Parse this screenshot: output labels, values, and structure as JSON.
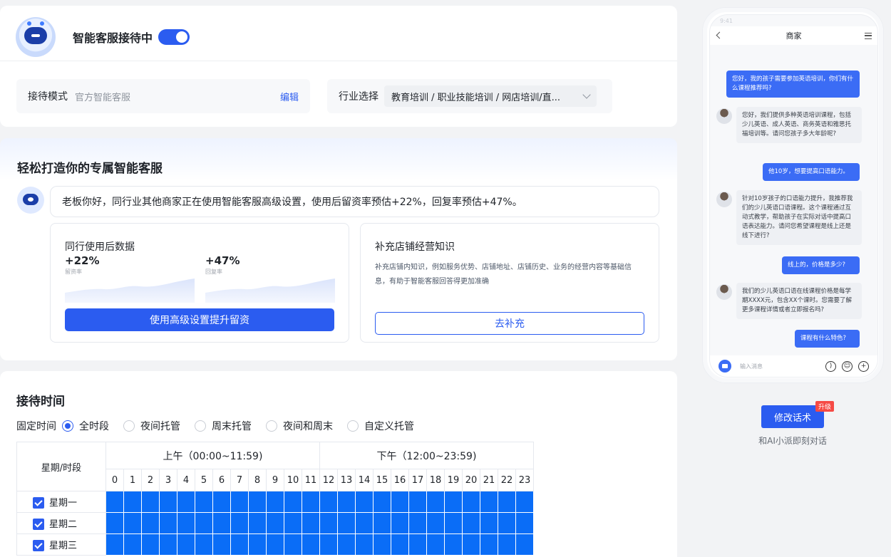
{
  "header": {
    "bot_title": "智能客服接待中",
    "toggle_on": true,
    "mode_label": "接待模式",
    "mode_value": "官方智能客服",
    "edit_label": "编辑",
    "industry_label": "行业选择",
    "industry_value": "教育培训 / 职业技能培训 / 网店培训/直..."
  },
  "promo": {
    "title": "轻松打造你的专属智能客服",
    "message": "老板你好，同行业其他商家正在使用智能客服高级设置，使用后留资率预估+22%，回复率预估+47%。",
    "stats_title": "同行使用后数据",
    "stats": [
      {
        "value": "+22%",
        "label": "留资率"
      },
      {
        "value": "+47%",
        "label": "回复率"
      }
    ],
    "primary_button": "使用高级设置提升留资",
    "supplement_title": "补充店铺经营知识",
    "supplement_desc": "补充店铺内知识，例如服务优势、店铺地址、店铺历史、业务的经营内容等基础信息，有助于智能客服回答得更加准确",
    "supplement_button": "去补充"
  },
  "reception": {
    "title": "接待时间",
    "fixed_label": "固定时间",
    "options": [
      "全时段",
      "夜间托管",
      "周末托管",
      "夜间和周末",
      "自定义托管"
    ],
    "selected": "全时段",
    "table_header": "星期/时段",
    "morning_label": "上午（00:00~11:59)",
    "afternoon_label": "下午（12:00~23:59)",
    "hours": [
      "0",
      "1",
      "2",
      "3",
      "4",
      "5",
      "6",
      "7",
      "8",
      "9",
      "10",
      "11",
      "12",
      "13",
      "14",
      "15",
      "16",
      "17",
      "18",
      "19",
      "20",
      "21",
      "22",
      "23"
    ],
    "days": [
      "星期一",
      "星期二",
      "星期三"
    ]
  },
  "phone": {
    "time": "9:41",
    "title": "商家",
    "messages": [
      {
        "from": "me",
        "text": "您好，我的孩子需要参加英语培训，你们有什么课程推荐吗?"
      },
      {
        "from": "bot",
        "text": "您好，我们提供多种英语培训课程，包括少儿英语、成人英语、商务英语和雅思托福培训等。请问您孩子多大年龄呢?"
      },
      {
        "from": "me",
        "text": "他10岁，想要提高口语能力。"
      },
      {
        "from": "bot",
        "text": "针对10岁孩子的口语能力提升，我推荐我们的少儿英语口语课程。这个课程通过互动式教学，帮助孩子在实际对话中提高口语表达能力。请问您希望课程是线上还是线下进行?"
      },
      {
        "from": "me",
        "text": "线上的，价格是多少?"
      },
      {
        "from": "bot",
        "text": "我们的少儿英语口语在线课程价格是每学期XXXX元，包含XX个课时。您需要了解更多课程详情或者立即报名吗?"
      },
      {
        "from": "me",
        "text": "课程有什么特色?"
      }
    ],
    "input_placeholder": "输入消息"
  },
  "upgrade": {
    "button": "修改话术",
    "tag": "升级",
    "subtitle": "和AI小派即刻对话"
  },
  "colors": {
    "primary": "#2b5cf0",
    "slot": "#0a6df7",
    "tag": "#f54a45"
  }
}
